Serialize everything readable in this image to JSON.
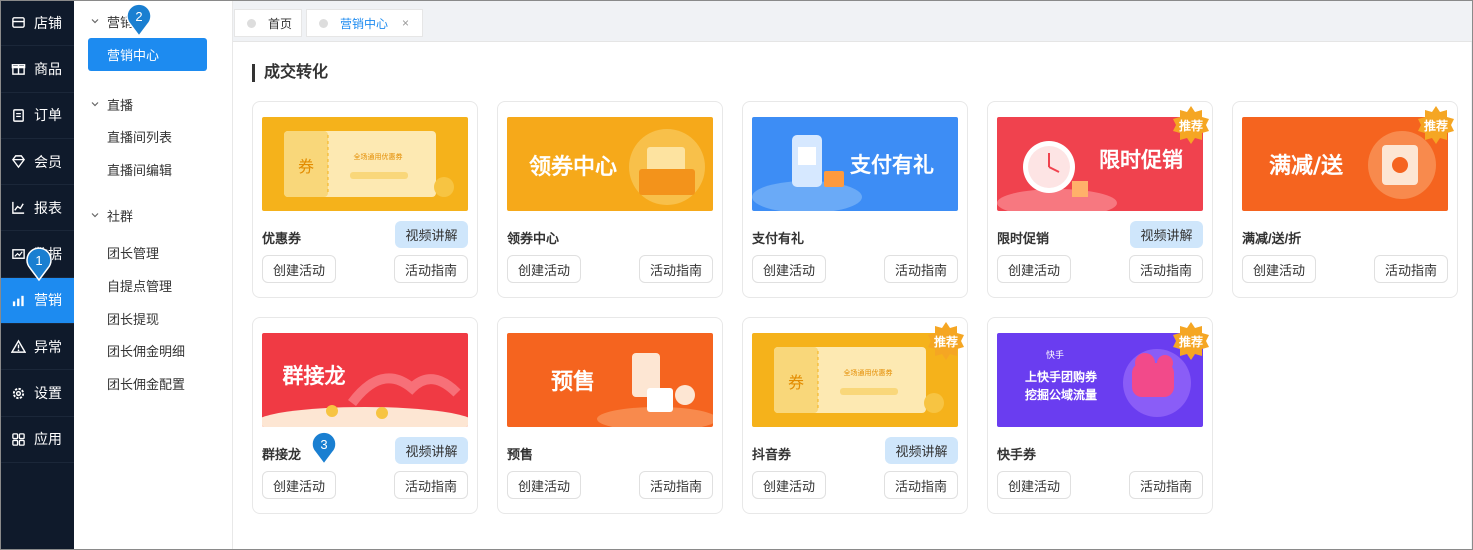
{
  "nav": {
    "items": [
      {
        "label": "店铺",
        "icon": "store-icon"
      },
      {
        "label": "商品",
        "icon": "gift-icon"
      },
      {
        "label": "订单",
        "icon": "order-icon"
      },
      {
        "label": "会员",
        "icon": "member-icon"
      },
      {
        "label": "报表",
        "icon": "report-icon"
      },
      {
        "label": "数据",
        "icon": "data-icon"
      },
      {
        "label": "营销",
        "icon": "marketing-icon"
      },
      {
        "label": "异常",
        "icon": "warning-icon"
      },
      {
        "label": "设置",
        "icon": "gear-icon"
      },
      {
        "label": "应用",
        "icon": "apps-icon"
      }
    ],
    "active_index": 6
  },
  "subnav": {
    "groups": [
      {
        "title": "营销",
        "items": [
          "营销中心"
        ]
      },
      {
        "title": "直播",
        "items": [
          "直播间列表",
          "直播间编辑"
        ]
      },
      {
        "title": "社群",
        "items": [
          "团长管理",
          "自提点管理",
          "团长提现",
          "团长佣金明细",
          "团长佣金配置"
        ]
      }
    ],
    "active_item": "营销中心"
  },
  "tabs": [
    {
      "label": "首页"
    },
    {
      "label": "营销中心",
      "close": "×"
    }
  ],
  "section": {
    "title": "成交转化"
  },
  "buttons": {
    "create": "创建活动",
    "guide": "活动指南",
    "video": "视频讲解"
  },
  "badge_label": "推荐",
  "cards": [
    {
      "name": "优惠券",
      "video": true,
      "badge": false,
      "banner_text": "券",
      "banner_sub": "全场通用优惠券"
    },
    {
      "name": "领券中心",
      "video": false,
      "badge": false,
      "banner_text": "领券中心"
    },
    {
      "name": "支付有礼",
      "video": false,
      "badge": false,
      "banner_text": "支付有礼"
    },
    {
      "name": "限时促销",
      "video": true,
      "badge": true,
      "banner_text": "限时促销"
    },
    {
      "name": "满减/送/折",
      "video": false,
      "badge": true,
      "banner_text": "满减/送"
    },
    {
      "name": "群接龙",
      "video": true,
      "badge": false,
      "banner_text": "群接龙"
    },
    {
      "name": "预售",
      "video": false,
      "badge": false,
      "banner_text": "预售"
    },
    {
      "name": "抖音券",
      "video": true,
      "badge": true,
      "banner_text": "券",
      "banner_sub": "全场通用优惠券"
    },
    {
      "name": "快手券",
      "video": false,
      "badge": true,
      "banner_text": "上快手团购券",
      "banner_text2": "挖掘公域流量",
      "banner_logo": "快手"
    }
  ],
  "markers": [
    "1",
    "2",
    "3"
  ],
  "colors": {
    "accent": "#1d8bf0",
    "nav_bg": "#0f1a2b",
    "video_btn": "#cfe6fb",
    "badge": "#f5a623"
  }
}
